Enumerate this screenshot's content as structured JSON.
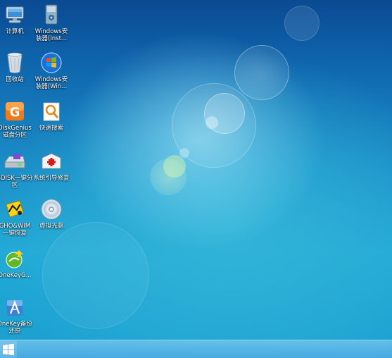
{
  "desktop": {
    "icons": [
      {
        "label": "计算机",
        "icon": "computer-icon"
      },
      {
        "label": "Windows安\n装器(Inst...",
        "icon": "windows-installer-icon"
      },
      {
        "label": "回收站",
        "icon": "recycle-bin-icon"
      },
      {
        "label": "Windows安\n装器(Win...",
        "icon": "windows-logo-icon"
      },
      {
        "label": "DiskGenius\n磁盘分区",
        "icon": "diskgenius-icon"
      },
      {
        "label": "快速搜索",
        "icon": "quick-search-icon"
      },
      {
        "label": "SDISK一键分\n区",
        "icon": "sdisk-partition-icon"
      },
      {
        "label": "系统引导修复",
        "icon": "boot-repair-icon"
      },
      {
        "label": "GHO&WIM\n一键恢复",
        "icon": "gho-wim-restore-icon"
      },
      {
        "label": "虚拟光驱",
        "icon": "virtual-drive-icon"
      },
      {
        "label": "OneKeyG...",
        "icon": "onekey-ghost-icon"
      },
      {
        "label": "OneKey备份\n还原",
        "icon": "onekey-backup-icon"
      }
    ]
  },
  "taskbar": {
    "start_icon": "windows-start-icon"
  },
  "colors": {
    "taskbar": "#5aaee0",
    "background_top": "#0a4a93",
    "background_bottom": "#22a9d6"
  }
}
